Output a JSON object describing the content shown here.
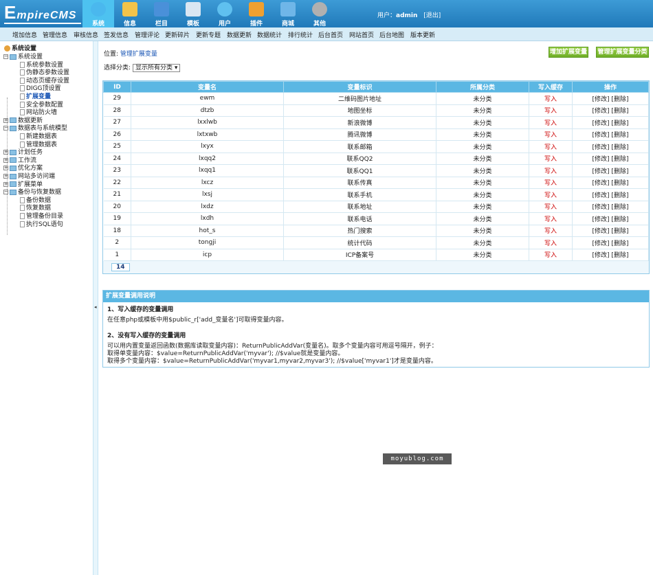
{
  "logo": {
    "first": "E",
    "rest": "mpireCMS"
  },
  "topnav": [
    {
      "label": "系统",
      "icon": "globe-icon",
      "active": true
    },
    {
      "label": "信息",
      "icon": "document-icon"
    },
    {
      "label": "栏目",
      "icon": "folder-icon"
    },
    {
      "label": "模板",
      "icon": "template-icon"
    },
    {
      "label": "用户",
      "icon": "user-icon"
    },
    {
      "label": "插件",
      "icon": "tools-icon"
    },
    {
      "label": "商城",
      "icon": "shop-icon"
    },
    {
      "label": "其他",
      "icon": "gear-icon"
    }
  ],
  "user": {
    "prefix": "用户：",
    "name": "admin",
    "logout": "[退出]"
  },
  "subnav": [
    "增加信息",
    "管理信息",
    "审核信息",
    "签发信息",
    "管理评论",
    "更新碎片",
    "更新专题",
    "数据更新",
    "数据统计",
    "排行统计",
    "后台首页",
    "网站首页",
    "后台地图",
    "版本更新"
  ],
  "sidebar": {
    "root": "系统设置",
    "items": [
      {
        "label": "系统设置",
        "level": 1,
        "type": "folder",
        "open": true
      },
      {
        "label": "系统参数设置",
        "level": 2,
        "type": "page"
      },
      {
        "label": "伪静态参数设置",
        "level": 2,
        "type": "page"
      },
      {
        "label": "动态页缓存设置",
        "level": 2,
        "type": "page"
      },
      {
        "label": "DIGG顶设置",
        "level": 2,
        "type": "page"
      },
      {
        "label": "扩展变量",
        "level": 2,
        "type": "page",
        "selected": true
      },
      {
        "label": "安全参数配置",
        "level": 2,
        "type": "page"
      },
      {
        "label": "网站防火墙",
        "level": 2,
        "type": "page"
      },
      {
        "label": "数据更新",
        "level": 1,
        "type": "folder"
      },
      {
        "label": "数据表与系统模型",
        "level": 1,
        "type": "folder",
        "open": true
      },
      {
        "label": "新建数据表",
        "level": 2,
        "type": "page"
      },
      {
        "label": "管理数据表",
        "level": 2,
        "type": "page"
      },
      {
        "label": "计划任务",
        "level": 1,
        "type": "folder"
      },
      {
        "label": "工作流",
        "level": 1,
        "type": "folder"
      },
      {
        "label": "优化方案",
        "level": 1,
        "type": "folder"
      },
      {
        "label": "网站多访问端",
        "level": 1,
        "type": "folder"
      },
      {
        "label": "扩展菜单",
        "level": 1,
        "type": "folder"
      },
      {
        "label": "备份与恢复数据",
        "level": 1,
        "type": "folder",
        "open": true
      },
      {
        "label": "备份数据",
        "level": 2,
        "type": "page"
      },
      {
        "label": "恢复数据",
        "level": 2,
        "type": "page"
      },
      {
        "label": "管理备份目录",
        "level": 2,
        "type": "page"
      },
      {
        "label": "执行SQL语句",
        "level": 2,
        "type": "page"
      }
    ]
  },
  "splitter_arrow": "◂",
  "location": {
    "prefix": "位置: ",
    "link": "管理扩展变量"
  },
  "buttons": {
    "add": "增加扩展变量",
    "manage_cat": "管理扩展变量分类"
  },
  "filter": {
    "label": "选择分类:",
    "value": "显示所有分类 ▾"
  },
  "table": {
    "headers": [
      "ID",
      "变量名",
      "变量标识",
      "所属分类",
      "写入缓存",
      "操作"
    ],
    "rows": [
      {
        "id": "29",
        "name": "ewm",
        "ident": "二维码图片地址",
        "cat": "未分类",
        "cache": "写入",
        "ops": "[修改] [删除]"
      },
      {
        "id": "28",
        "name": "dtzb",
        "ident": "地图坐标",
        "cat": "未分类",
        "cache": "写入",
        "ops": "[修改] [删除]"
      },
      {
        "id": "27",
        "name": "lxxlwb",
        "ident": "新浪微博",
        "cat": "未分类",
        "cache": "写入",
        "ops": "[修改] [删除]"
      },
      {
        "id": "26",
        "name": "lxtxwb",
        "ident": "腾讯微博",
        "cat": "未分类",
        "cache": "写入",
        "ops": "[修改] [删除]"
      },
      {
        "id": "25",
        "name": "lxyx",
        "ident": "联系邮箱",
        "cat": "未分类",
        "cache": "写入",
        "ops": "[修改] [删除]"
      },
      {
        "id": "24",
        "name": "lxqq2",
        "ident": "联系QQ2",
        "cat": "未分类",
        "cache": "写入",
        "ops": "[修改] [删除]"
      },
      {
        "id": "23",
        "name": "lxqq1",
        "ident": "联系QQ1",
        "cat": "未分类",
        "cache": "写入",
        "ops": "[修改] [删除]"
      },
      {
        "id": "22",
        "name": "lxcz",
        "ident": "联系传真",
        "cat": "未分类",
        "cache": "写入",
        "ops": "[修改] [删除]"
      },
      {
        "id": "21",
        "name": "lxsj",
        "ident": "联系手机",
        "cat": "未分类",
        "cache": "写入",
        "ops": "[修改] [删除]"
      },
      {
        "id": "20",
        "name": "lxdz",
        "ident": "联系地址",
        "cat": "未分类",
        "cache": "写入",
        "ops": "[修改] [删除]"
      },
      {
        "id": "19",
        "name": "lxdh",
        "ident": "联系电话",
        "cat": "未分类",
        "cache": "写入",
        "ops": "[修改] [删除]"
      },
      {
        "id": "18",
        "name": "hot_s",
        "ident": "热门搜索",
        "cat": "未分类",
        "cache": "写入",
        "ops": "[修改] [删除]"
      },
      {
        "id": "2",
        "name": "tongji",
        "ident": "统计代码",
        "cat": "未分类",
        "cache": "写入",
        "ops": "[修改] [删除]"
      },
      {
        "id": "1",
        "name": "icp",
        "ident": "ICP备案号",
        "cat": "未分类",
        "cache": "写入",
        "ops": "[修改] [删除]"
      }
    ],
    "count": "14"
  },
  "help": {
    "title": "扩展变量调用说明",
    "s1_title": "1、写入缓存的变量调用",
    "s1_text": "在任意php或模板中用$public_r['add_变量名']可取得变量内容。",
    "s2_title": "2、没有写入缓存的变量调用",
    "s2_line1": "可以用内置变量返回函数(数据库读取变量内容)：ReturnPublicAddVar(变量名)。取多个变量内容可用逗号隔开，例子：",
    "s2_line2": "取得单变量内容：$value=ReturnPublicAddVar('myvar'); //$value就是变量内容。",
    "s2_line3": "取得多个变量内容：$value=ReturnPublicAddVar('myvar1,myvar2,myvar3'); //$value['myvar1']才是变量内容。"
  },
  "watermark": "moyublog.com",
  "colors": {
    "header": "#2a86c5",
    "active_tab": "#4dc2f0",
    "table_head": "#5bb7e3",
    "green_button": "#7bbd2f",
    "red_text": "#cc0000"
  }
}
